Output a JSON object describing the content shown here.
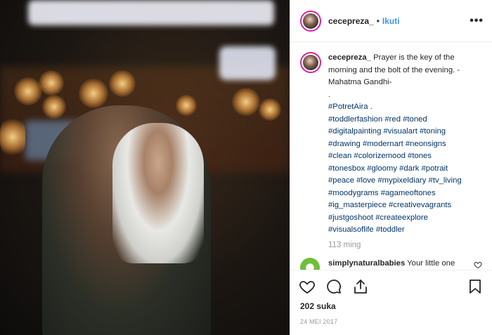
{
  "post": {
    "username": "cecepreza_",
    "separator": "•",
    "follow_label": "Ikuti",
    "more_label": "•••",
    "caption_text": " Prayer is the key of the morning and the bolt of the evening. - Mahatma Gandhi-",
    "caption_dot": ".",
    "hashtags": [
      "#PotretAira .",
      "#toddlerfashion #red #toned",
      "#digitalpainting #visualart #toning",
      "#drawing #modernart #neonsigns",
      "#clean #colorizemood #tones",
      "#tonesbox #gloomy #dark #potrait",
      "#peace #love #mypixeldiary #tv_living",
      "#moodygrams #agameoftones",
      "#ig_masterpiece #creativevagrants",
      "#justgoshoot #createexplore",
      "#visualsoflife #toddler"
    ],
    "time_ago": "113 ming"
  },
  "comment": {
    "username": "simplynaturalbabies",
    "text": " Your little one might love our easy clean-up"
  },
  "footer": {
    "likes": "202 suka",
    "date": "24 MEI 2017"
  },
  "icons": [
    "heart-icon",
    "comment-icon",
    "share-icon",
    "bookmark-icon",
    "more-icon"
  ],
  "colors": {
    "follow": "#3897f0",
    "hashtag": "#003569",
    "meta": "#999999",
    "text": "#262626"
  }
}
